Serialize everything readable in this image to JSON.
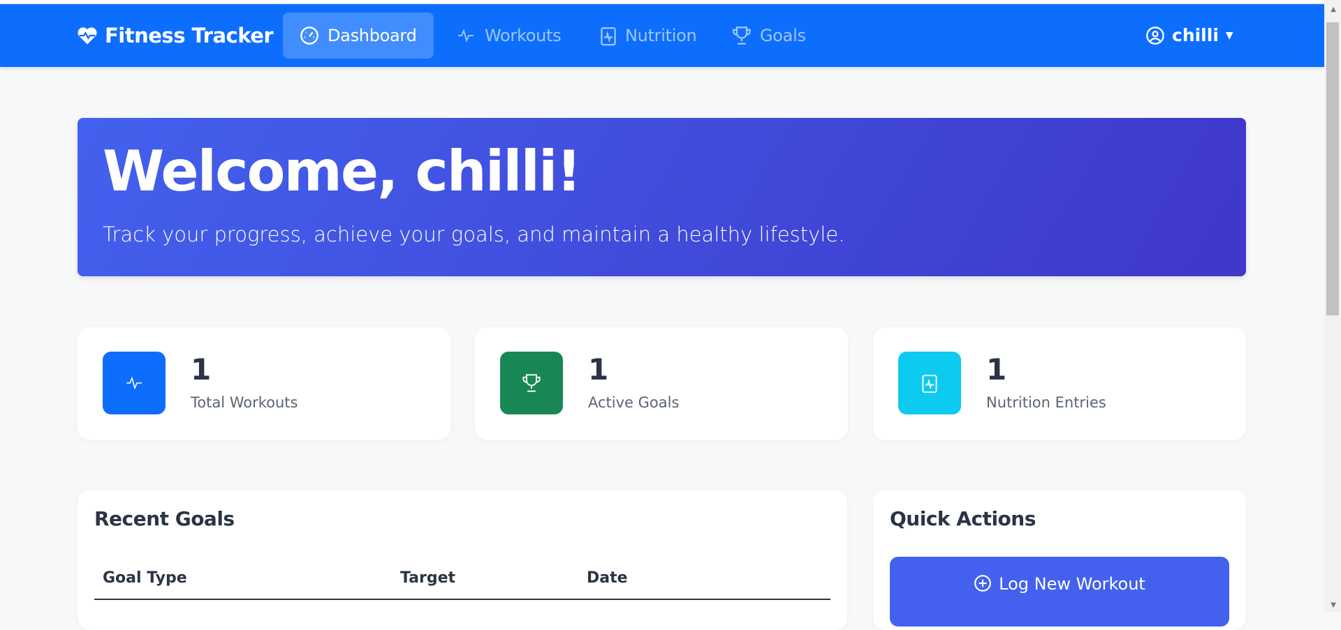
{
  "nav": {
    "brand": "Fitness Tracker",
    "items": [
      {
        "label": "Dashboard"
      },
      {
        "label": "Workouts"
      },
      {
        "label": "Nutrition"
      },
      {
        "label": "Goals"
      }
    ],
    "user": "chilli"
  },
  "hero": {
    "title": "Welcome, chilli!",
    "subtitle": "Track your progress, achieve your goals, and maintain a healthy lifestyle."
  },
  "stats": [
    {
      "value": "1",
      "label": "Total Workouts",
      "color": "#0d6efd"
    },
    {
      "value": "1",
      "label": "Active Goals",
      "color": "#198754"
    },
    {
      "value": "1",
      "label": "Nutrition Entries",
      "color": "#0dcaf0"
    }
  ],
  "goals": {
    "title": "Recent Goals",
    "columns": [
      "Goal Type",
      "Target",
      "Date"
    ]
  },
  "quick": {
    "title": "Quick Actions",
    "log_workout": "Log New Workout"
  }
}
